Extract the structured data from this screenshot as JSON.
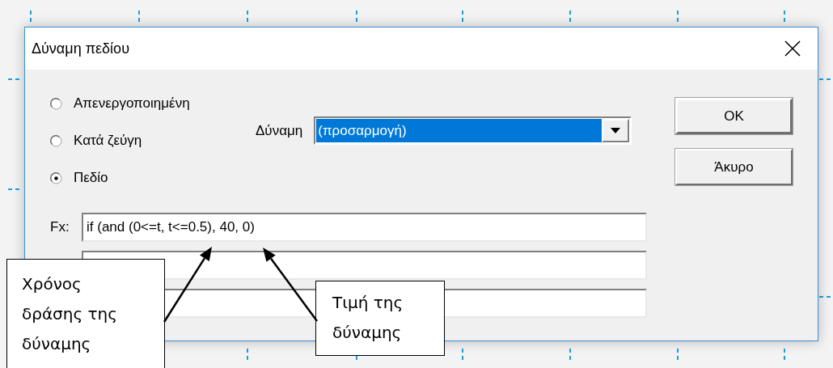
{
  "window": {
    "title": "Δύναμη πεδίου"
  },
  "mode_options": [
    {
      "label": "Απενεργοποιημένη",
      "selected": false
    },
    {
      "label": "Κατά ζεύγη",
      "selected": false
    },
    {
      "label": "Πεδίο",
      "selected": true
    }
  ],
  "force": {
    "label": "Δύναμη",
    "value": "(προσαρμογή)"
  },
  "buttons": [
    "OK",
    "Άκυρο"
  ],
  "fields": [
    {
      "kind": "filled",
      "label": "Fx:",
      "value": "if (and (0<=t, t<=0.5), 40, 0)"
    },
    {
      "kind": "empty"
    },
    {
      "kind": "empty"
    }
  ],
  "callouts": [
    {
      "text": "Χρόνος δράσης της δύναμης"
    },
    {
      "text": "Τιμή της δύναμης"
    }
  ]
}
